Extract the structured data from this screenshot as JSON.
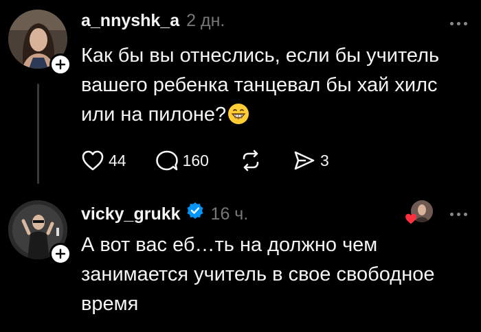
{
  "post1": {
    "username": "a_nnyshk_a",
    "time": "2 дн.",
    "text_lines": [
      "Как бы вы отнеслись, если бы учитель",
      "вашего ребенка танцевал бы хай хилс",
      "или на пилоне?"
    ],
    "emoji": "grinning-face-emoji",
    "actions": {
      "likes": "44",
      "replies": "160",
      "repost_icon": "repost-icon",
      "shares": "3"
    }
  },
  "post2": {
    "username": "vicky_grukk",
    "verified": true,
    "time": "16 ч.",
    "text_lines": [
      "А вот вас еб…ть на должно чем",
      "занимается учитель в свое свободное",
      "время"
    ]
  },
  "colors": {
    "background": "#000000",
    "text": "#f3f5f7",
    "muted": "#777777",
    "verified_blue": "#0095f6",
    "heart_red": "#ff3040"
  }
}
